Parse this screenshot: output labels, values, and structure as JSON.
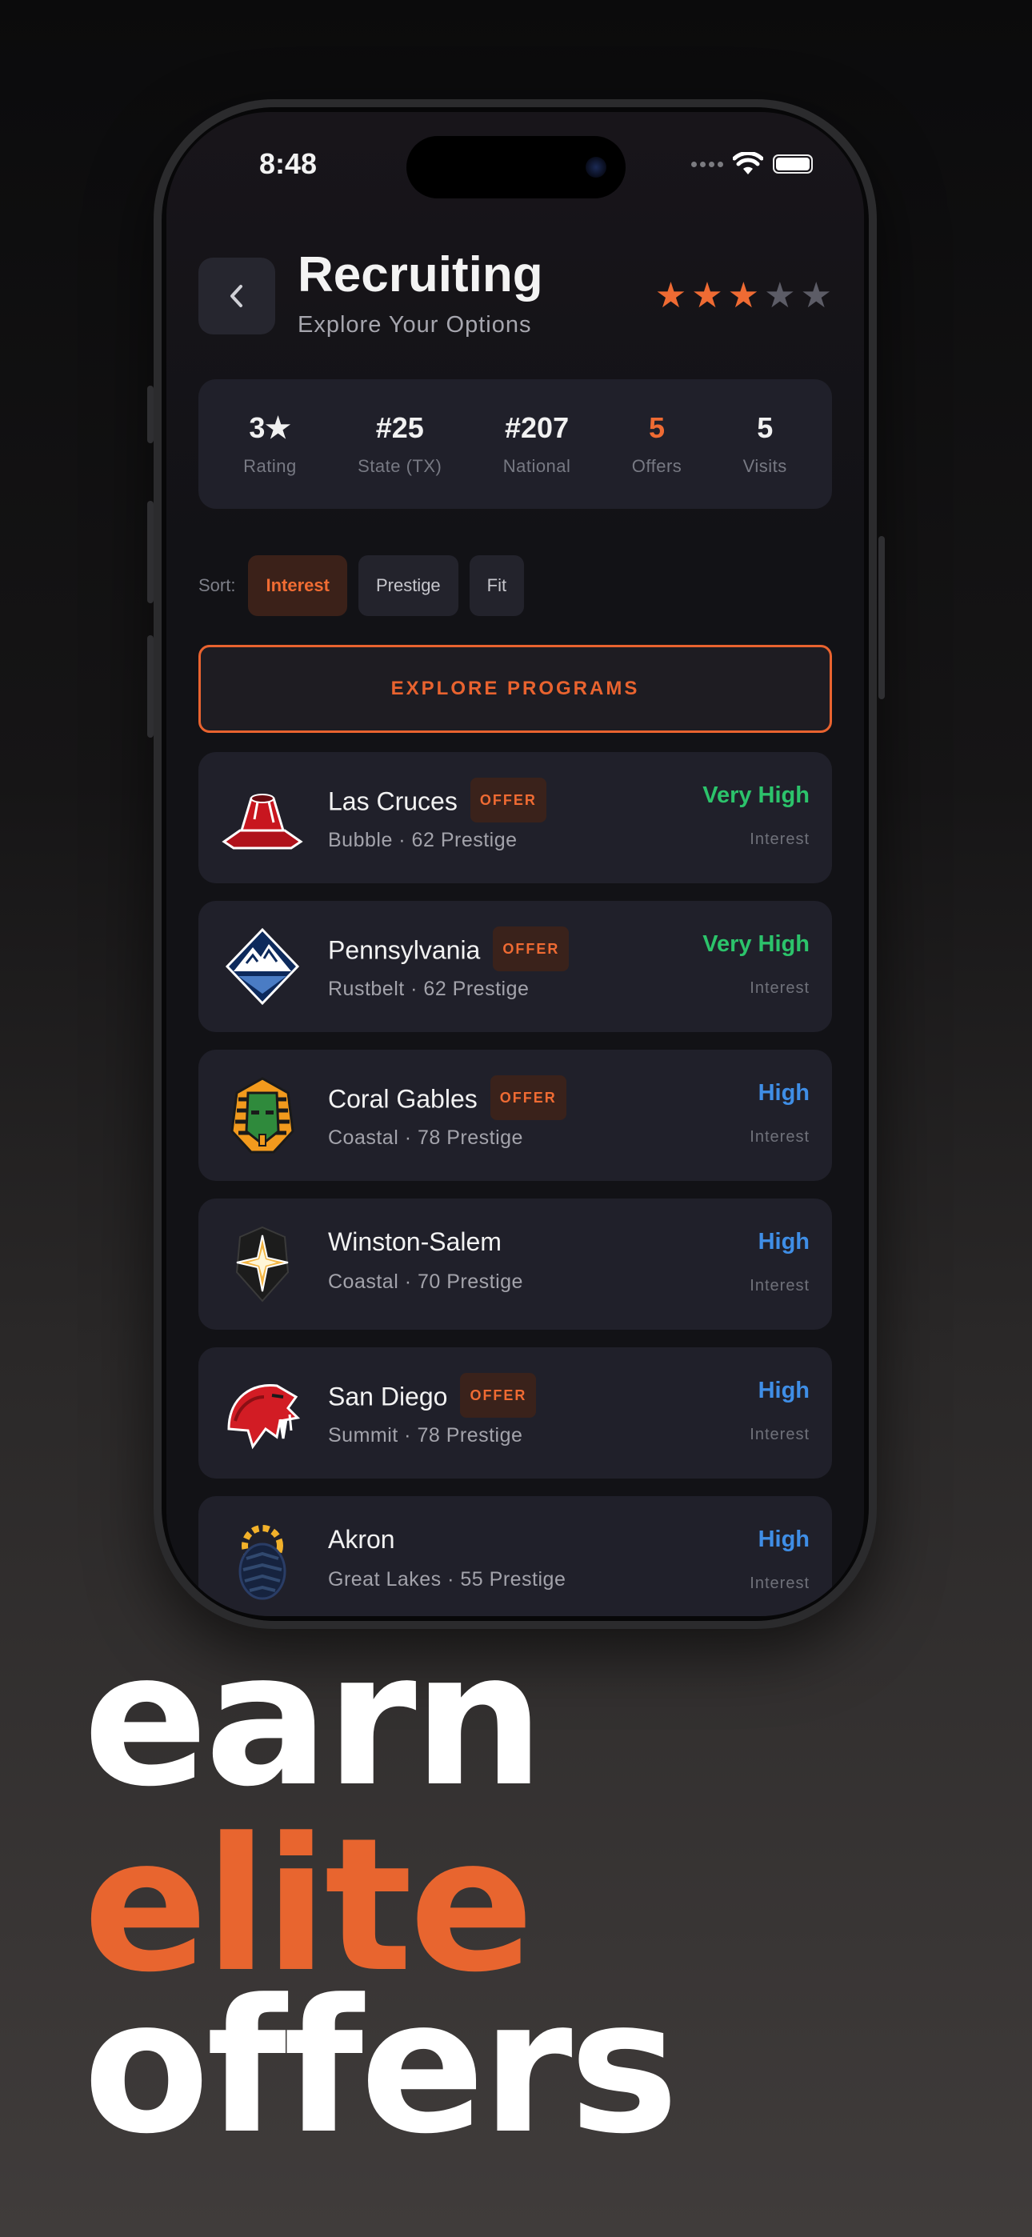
{
  "status_bar": {
    "time": "8:48"
  },
  "header": {
    "title": "Recruiting",
    "subtitle": "Explore Your Options"
  },
  "rating_stars": {
    "filled": 3,
    "total": 5,
    "filled_color": "#ef6b33",
    "empty_color": "#5c5c66"
  },
  "stats": [
    {
      "value": "3★",
      "label": "Rating"
    },
    {
      "value": "#25",
      "label": "State (TX)"
    },
    {
      "value": "#207",
      "label": "National"
    },
    {
      "value": "5",
      "label": "Offers",
      "accent": true
    },
    {
      "value": "5",
      "label": "Visits"
    }
  ],
  "sort": {
    "label": "Sort:",
    "options": [
      "Interest",
      "Prestige",
      "Fit"
    ],
    "selected": "Interest"
  },
  "explore_button": "EXPLORE PROGRAMS",
  "programs": [
    {
      "name": "Las Cruces",
      "offer": "OFFER",
      "region": "Bubble · 62 Prestige",
      "interest": "Very High",
      "interest_label": "Interest",
      "logo": "volcano-icon"
    },
    {
      "name": "Pennsylvania",
      "offer": "OFFER",
      "region": "Rustbelt · 62 Prestige",
      "interest": "Very High",
      "interest_label": "Interest",
      "logo": "mountain-icon"
    },
    {
      "name": "Coral Gables",
      "offer": "OFFER",
      "region": "Coastal · 78 Prestige",
      "interest": "High",
      "interest_label": "Interest",
      "logo": "pharaoh-icon"
    },
    {
      "name": "Winston-Salem",
      "offer": "",
      "region": "Coastal · 70 Prestige",
      "interest": "High",
      "interest_label": "Interest",
      "logo": "compass-star-icon"
    },
    {
      "name": "San Diego",
      "offer": "OFFER",
      "region": "Summit · 78 Prestige",
      "interest": "High",
      "interest_label": "Interest",
      "logo": "sabertooth-icon"
    },
    {
      "name": "Akron",
      "offer": "",
      "region": "Great Lakes · 55 Prestige",
      "interest": "High",
      "interest_label": "Interest",
      "logo": "gear-tire-icon"
    }
  ],
  "tagline": {
    "line1": "earn",
    "line2": "elite",
    "line3": "offers",
    "accent_color": "#e8652f"
  }
}
